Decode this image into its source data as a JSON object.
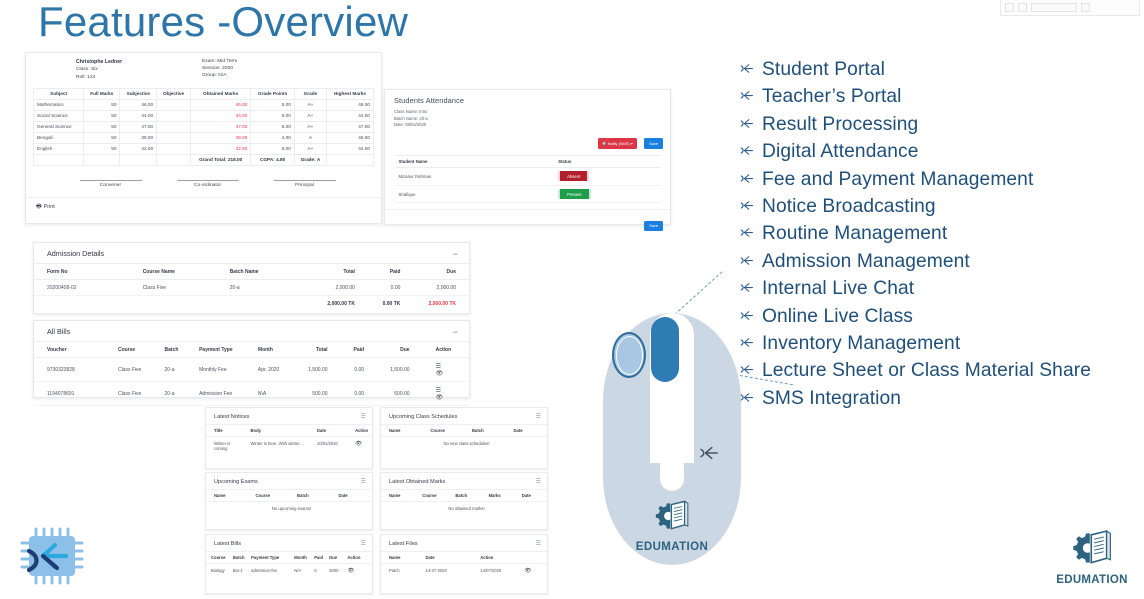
{
  "slide": {
    "title": "Features -Overview"
  },
  "marksheet": {
    "student": {
      "name": "Christophe Ledner",
      "class": "Class: Six",
      "roll": "Roll: 124"
    },
    "exam": {
      "exam": "Exam: Mid Term",
      "session": "Session: 2020",
      "group": "Group: N/A"
    },
    "columns": [
      "Subject",
      "Full Marks",
      "Subjective",
      "Objective",
      "Obtained Marks",
      "Grade Points",
      "Grade",
      "Highest Marks"
    ],
    "rows": [
      {
        "subject": "Mathematics",
        "full": "50",
        "subjective": "46.00",
        "objective": "",
        "obtained": "46.00",
        "points": "5.00",
        "grade": "A+",
        "highest": "46.00"
      },
      {
        "subject": "Social Science",
        "full": "50",
        "subjective": "44.00",
        "objective": "",
        "obtained": "44.00",
        "points": "5.00",
        "grade": "A+",
        "highest": "44.00"
      },
      {
        "subject": "General Science",
        "full": "50",
        "subjective": "47.00",
        "objective": "",
        "obtained": "47.00",
        "points": "5.00",
        "grade": "A+",
        "highest": "47.00"
      },
      {
        "subject": "Bengali",
        "full": "50",
        "subjective": "39.00",
        "objective": "",
        "obtained": "39.00",
        "points": "4.00",
        "grade": "A",
        "highest": "46.00"
      },
      {
        "subject": "English",
        "full": "50",
        "subjective": "42.00",
        "objective": "",
        "obtained": "42.00",
        "points": "5.00",
        "grade": "A+",
        "highest": "44.00"
      }
    ],
    "summary": {
      "grand_total": "Grand Total: 218.00",
      "cgpa": "CGPA: 4.80",
      "grade": "Grade: A"
    },
    "signatures": [
      "Convener",
      "Co-ordinator",
      "Principal"
    ],
    "print_label": "Print",
    "print_icon": "printer-icon"
  },
  "attendance": {
    "title": "Students Attendance",
    "class_name": "Class Name: Intro",
    "batch_name": "Batch Name: 20-a",
    "date": "Date: 08/04/2020",
    "notify_label": "Notify (SMS)",
    "notify_caret": "▾",
    "save_label": "Save",
    "columns": [
      "Student Name",
      "Status"
    ],
    "rows": [
      {
        "name": "Mizanur Rahman",
        "status": "Absent",
        "state": "absent"
      },
      {
        "name": "Shafique",
        "status": "Present",
        "state": "present"
      }
    ],
    "footer_save_label": "Save"
  },
  "admission": {
    "title": "Admission Details",
    "collapse": "−",
    "columns": [
      "Form No",
      "Course Name",
      "Batch Name",
      "Total",
      "Paid",
      "Due"
    ],
    "rows": [
      {
        "form_no": "20200408-02",
        "course": "Class Five",
        "batch": "20-a",
        "total": "2,000.00",
        "paid": "0.00",
        "due": "2,000.00"
      }
    ],
    "summary": {
      "total": "2,000.00 TK",
      "paid": "0.00 TK",
      "due": "2,000.00 TK"
    }
  },
  "all_bills": {
    "title": "All Bills",
    "collapse": "−",
    "columns": [
      "Voucher",
      "Course",
      "Batch",
      "Payment Type",
      "Month",
      "Total",
      "Paid",
      "Due",
      "Action"
    ],
    "rows": [
      {
        "voucher": "9730323828",
        "course": "Class Five",
        "batch": "20-a",
        "payment_type": "Monthly Fee",
        "month": "Apr, 2020",
        "total": "1,500.00",
        "paid": "0.00",
        "due": "1,500.00"
      },
      {
        "voucher": "1194078691",
        "course": "Class Five",
        "batch": "20-a",
        "payment_type": "Admission Fee",
        "month": "N\\A",
        "total": "500.00",
        "paid": "0.00",
        "due": "500.00"
      }
    ],
    "action_icons": [
      "card-icon",
      "eye-icon"
    ]
  },
  "dashboard": {
    "latest_notices": {
      "title": "Latest Notices",
      "columns": [
        "Title",
        "Body",
        "Date",
        "Action"
      ],
      "rows": [
        {
          "title": "Winter is coming",
          "body": "Winter is here. With winter....",
          "date": "10/01/2020",
          "action": "eye-icon"
        }
      ]
    },
    "upcoming_class_schedules": {
      "title": "Upcoming Class Schedules",
      "columns": [
        "Name",
        "Course",
        "Batch",
        "Date"
      ],
      "empty": "No new class schedules!"
    },
    "upcoming_exams": {
      "title": "Upcoming Exams",
      "columns": [
        "Name",
        "Course",
        "Batch",
        "Date"
      ],
      "empty": "No upcoming exams!"
    },
    "latest_obtained_marks": {
      "title": "Latest Obtained Marks",
      "columns": [
        "Name",
        "Course",
        "Batch",
        "Marks",
        "Date"
      ],
      "empty": "No obtained marks!"
    },
    "latest_bills": {
      "title": "Latest Bills",
      "columns": [
        "Course",
        "Batch",
        "Payment Type",
        "Month",
        "Paid",
        "Due",
        "Action"
      ],
      "rows": [
        {
          "course": "Biology",
          "batch": "Bio-1",
          "payment_type": "admission-fee",
          "month": "N/A",
          "paid": "0",
          "due": "3000",
          "action": "eye-icon"
        }
      ]
    },
    "latest_files": {
      "title": "Latest Files",
      "columns": [
        "Name",
        "Date",
        "Action"
      ],
      "rows": [
        {
          "name": "Patch",
          "date": "14-07-2020",
          "action_date": "14/07/2020",
          "action": "eye-icon"
        }
      ]
    }
  },
  "features": {
    "bullet": "bird-bullet-icon",
    "items": [
      "Student Portal",
      "Teacher’s Portal",
      "Result Processing",
      "Digital Attendance",
      "Fee and Payment Management",
      "Notice Broadcasting",
      "Routine Management",
      "Admission  Management",
      "Internal Live Chat",
      "Online Live Class",
      "Inventory  Management",
      "Lecture Sheet or Class Material Share",
      "SMS Integration"
    ]
  },
  "mouse_graphic": {
    "brand": "EDUMATION"
  },
  "bottom_right_logo": {
    "brand": "EDUMATION"
  },
  "colors": {
    "title_blue": "#2e75a8",
    "feature_blue": "#1f4e79",
    "accent_red": "#e4354a",
    "present_green": "#1e9e4a",
    "absent_red": "#b21f2d",
    "mouse_body": "#ccd7e4",
    "mouse_wheel": "#2f7cb5",
    "brand_teal": "#2d6380"
  }
}
